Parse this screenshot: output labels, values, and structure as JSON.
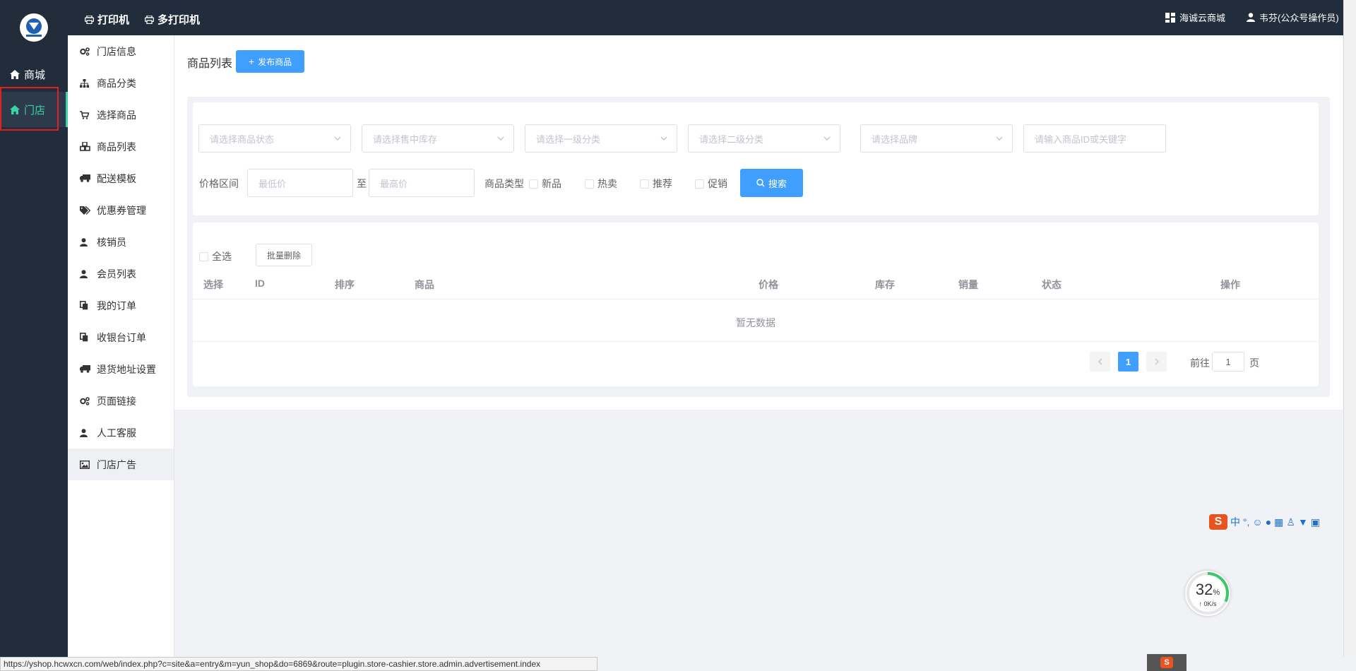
{
  "topnav": {
    "print_label": "打印机",
    "multi_print_label": "多打印机",
    "store_link": "海诚云商城",
    "user_label": "韦芬(公众号操作员)"
  },
  "mainnav": {
    "items": [
      {
        "label": "商城",
        "icon": "home-icon"
      },
      {
        "label": "门店",
        "icon": "home-icon",
        "active": true
      }
    ]
  },
  "submenu": {
    "items": [
      {
        "label": "门店信息",
        "icon": "cogs-icon"
      },
      {
        "label": "商品分类",
        "icon": "sitemap-icon"
      },
      {
        "label": "选择商品",
        "icon": "cart-icon"
      },
      {
        "label": "商品列表",
        "icon": "cubes-icon"
      },
      {
        "label": "配送模板",
        "icon": "truck-icon"
      },
      {
        "label": "优惠券管理",
        "icon": "tags-icon"
      },
      {
        "label": "核销员",
        "icon": "user-icon"
      },
      {
        "label": "会员列表",
        "icon": "user-icon"
      },
      {
        "label": "我的订单",
        "icon": "copy-icon"
      },
      {
        "label": "收银台订单",
        "icon": "copy-icon"
      },
      {
        "label": "退货地址设置",
        "icon": "truck-icon"
      },
      {
        "label": "页面链接",
        "icon": "cogs-icon"
      },
      {
        "label": "人工客服",
        "icon": "user-icon"
      },
      {
        "label": "门店广告",
        "icon": "image-icon",
        "active": true
      }
    ]
  },
  "main": {
    "title": "商品列表",
    "publish_button": "发布商品",
    "filters": {
      "status_placeholder": "请选择商品状态",
      "stock_placeholder": "请选择售中库存",
      "cat1_placeholder": "请选择一级分类",
      "cat2_placeholder": "请选择二级分类",
      "brand_placeholder": "请选择品牌",
      "keyword_placeholder": "请输入商品ID或关键字",
      "price_range_label": "价格区间",
      "min_price_placeholder": "最低价",
      "to_label": "至",
      "max_price_placeholder": "最高价",
      "type_label": "商品类型",
      "types": [
        "新品",
        "热卖",
        "推荐",
        "促销"
      ],
      "search_button": "搜索"
    },
    "table": {
      "select_all": "全选",
      "batch_delete": "批量删除",
      "columns": [
        "选择",
        "ID",
        "排序",
        "商品",
        "价格",
        "库存",
        "销量",
        "状态",
        "操作"
      ],
      "empty_text": "暂无数据"
    },
    "pagination": {
      "current_page": "1",
      "goto_label": "前往",
      "page_input": "1",
      "page_suffix": "页"
    }
  },
  "statusbar": {
    "url": "https://yshop.hcwxcn.com/web/index.php?c=site&a=entry&m=yun_shop&do=6869&route=plugin.store-cashier.store.admin.advertisement.index"
  },
  "widgets": {
    "ime_text": "中 °,",
    "speed_percent": "32",
    "speed_percent_unit": "%",
    "speed_rate": "↑ 0K/s"
  },
  "colors": {
    "sidebar_bg": "#222d3c",
    "accent": "#3bd3a5",
    "primary": "#409eff",
    "highlight_border": "#e02020"
  }
}
